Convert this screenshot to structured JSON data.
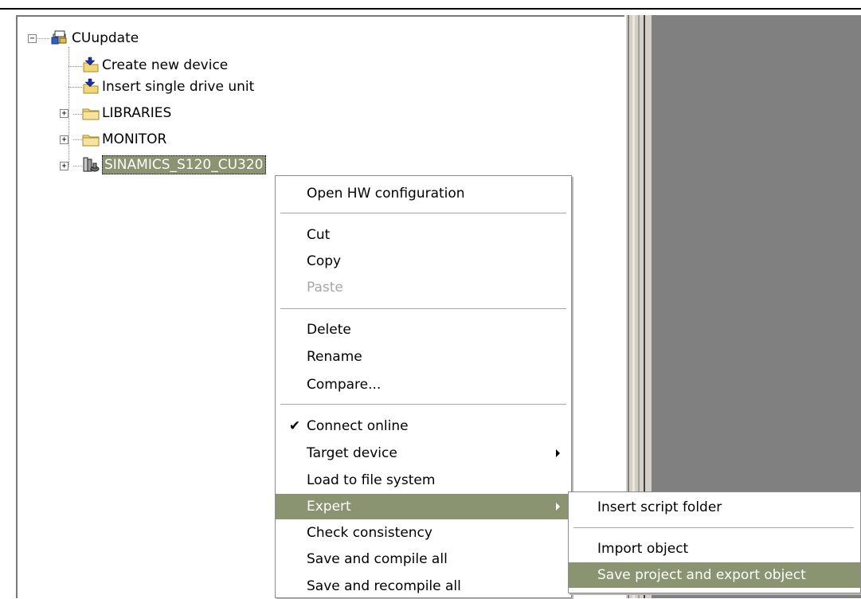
{
  "tree": {
    "root": {
      "label": "CUupdate",
      "icon": "project-icon",
      "expander": "−"
    },
    "items": [
      {
        "label": "Create new device",
        "icon": "insert-arrow-folder-icon"
      },
      {
        "label": "Insert single drive unit",
        "icon": "insert-arrow-folder-icon"
      },
      {
        "label": "LIBRARIES",
        "icon": "folder-icon",
        "expander": "+"
      },
      {
        "label": "MONITOR",
        "icon": "folder-icon",
        "expander": "+"
      },
      {
        "label": "SINAMICS_S120_CU320",
        "icon": "drive-device-icon",
        "expander": "+",
        "selected": true
      }
    ]
  },
  "context_menu": {
    "items": [
      {
        "label": "Open HW configuration"
      },
      {
        "label": "Cut"
      },
      {
        "label": "Copy"
      },
      {
        "label": "Paste",
        "disabled": true
      },
      {
        "label": "Delete"
      },
      {
        "label": "Rename"
      },
      {
        "label": "Compare..."
      },
      {
        "label": "Connect online",
        "checked": true,
        "check_glyph": "✔"
      },
      {
        "label": "Target device",
        "submenu": true
      },
      {
        "label": "Load to file system"
      },
      {
        "label": "Expert",
        "submenu": true,
        "highlighted": true
      },
      {
        "label": "Check consistency"
      },
      {
        "label": "Save and compile all"
      },
      {
        "label": "Save and recompile all"
      }
    ]
  },
  "expert_submenu": {
    "items": [
      {
        "label": "Insert script folder"
      },
      {
        "label": "Import object"
      },
      {
        "label": "Save project and export object",
        "highlighted": true
      }
    ]
  },
  "colors": {
    "selection": "#8a9471",
    "right_pane": "#808080",
    "disabled_text": "#a7a7a7"
  }
}
